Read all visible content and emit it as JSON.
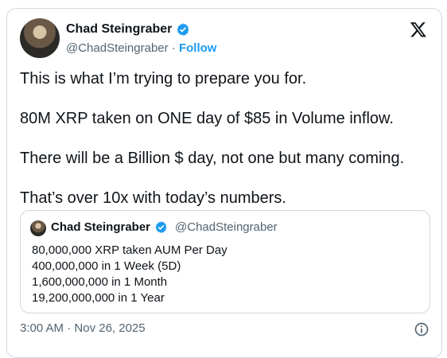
{
  "author": {
    "name": "Chad Steingraber",
    "handle": "@ChadSteingraber",
    "separator": " · ",
    "follow_label": "Follow"
  },
  "tweet_text": [
    "This is what I’m trying to prepare you for.",
    "80M XRP taken on ONE day of $85 in Volume inflow.",
    "There will be a Billion $ day, not one but many coming.",
    "That’s over 10x with today’s numbers."
  ],
  "quote": {
    "name": "Chad Steingraber",
    "handle": "@ChadSteingraber",
    "lines": [
      "80,000,000 XRP taken AUM Per Day",
      "400,000,000 in 1 Week (5D)",
      "1,600,000,000 in 1 Month",
      "19,200,000,000 in 1 Year"
    ]
  },
  "meta": {
    "time": "3:00 AM",
    "separator": " · ",
    "date": "Nov 26, 2025"
  },
  "icons": {
    "verified": "verified-badge-icon",
    "x_logo": "x-logo-icon",
    "info": "info-icon"
  },
  "colors": {
    "accent": "#1d9bf0",
    "secondary_text": "#536471",
    "border": "#cfd9de"
  }
}
